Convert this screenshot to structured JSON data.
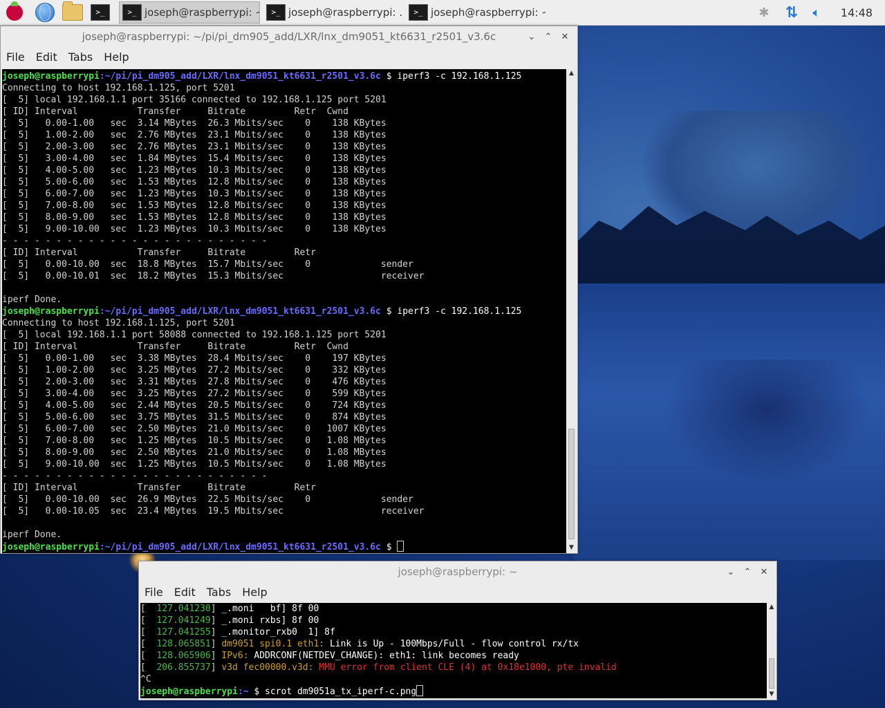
{
  "taskbar": {
    "tasks": [
      {
        "label": "joseph@raspberrypi: ~",
        "active": true
      },
      {
        "label": "joseph@raspberrypi: ..."
      },
      {
        "label": "joseph@raspberrypi: ~"
      }
    ],
    "clock": "14:48"
  },
  "win1": {
    "title": "joseph@raspberrypi: ~/pi/pi_dm905_add/LXR/lnx_dm9051_kt6631_r2501_v3.6c",
    "menu": [
      "File",
      "Edit",
      "Tabs",
      "Help"
    ],
    "prompt_user": "joseph@raspberrypi",
    "prompt_path": ":~/pi/pi_dm905_add/LXR/lnx_dm9051_kt6631_r2501_v3.6c",
    "prompt_sym": " $ ",
    "lines": [
      {
        "t": "prompt",
        "cmd": "iperf3 -c 192.168.1.125"
      },
      {
        "t": "text",
        "s": "Connecting to host 192.168.1.125, port 5201"
      },
      {
        "t": "text",
        "s": "[  5] local 192.168.1.1 port 35166 connected to 192.168.1.125 port 5201"
      },
      {
        "t": "text",
        "s": "[ ID] Interval           Transfer     Bitrate         Retr  Cwnd"
      },
      {
        "t": "text",
        "s": "[  5]   0.00-1.00   sec  3.14 MBytes  26.3 Mbits/sec    0    138 KBytes"
      },
      {
        "t": "text",
        "s": "[  5]   1.00-2.00   sec  2.76 MBytes  23.1 Mbits/sec    0    138 KBytes"
      },
      {
        "t": "text",
        "s": "[  5]   2.00-3.00   sec  2.76 MBytes  23.1 Mbits/sec    0    138 KBytes"
      },
      {
        "t": "text",
        "s": "[  5]   3.00-4.00   sec  1.84 MBytes  15.4 Mbits/sec    0    138 KBytes"
      },
      {
        "t": "text",
        "s": "[  5]   4.00-5.00   sec  1.23 MBytes  10.3 Mbits/sec    0    138 KBytes"
      },
      {
        "t": "text",
        "s": "[  5]   5.00-6.00   sec  1.53 MBytes  12.8 Mbits/sec    0    138 KBytes"
      },
      {
        "t": "text",
        "s": "[  5]   6.00-7.00   sec  1.23 MBytes  10.3 Mbits/sec    0    138 KBytes"
      },
      {
        "t": "text",
        "s": "[  5]   7.00-8.00   sec  1.53 MBytes  12.8 Mbits/sec    0    138 KBytes"
      },
      {
        "t": "text",
        "s": "[  5]   8.00-9.00   sec  1.53 MBytes  12.8 Mbits/sec    0    138 KBytes"
      },
      {
        "t": "text",
        "s": "[  5]   9.00-10.00  sec  1.23 MBytes  10.3 Mbits/sec    0    138 KBytes"
      },
      {
        "t": "text",
        "s": "- - - - - - - - - - - - - - - - - - - - - - - - -"
      },
      {
        "t": "text",
        "s": "[ ID] Interval           Transfer     Bitrate         Retr"
      },
      {
        "t": "text",
        "s": "[  5]   0.00-10.00  sec  18.8 MBytes  15.7 Mbits/sec    0             sender"
      },
      {
        "t": "text",
        "s": "[  5]   0.00-10.01  sec  18.2 MBytes  15.3 Mbits/sec                  receiver"
      },
      {
        "t": "text",
        "s": ""
      },
      {
        "t": "text",
        "s": "iperf Done."
      },
      {
        "t": "prompt",
        "cmd": "iperf3 -c 192.168.1.125"
      },
      {
        "t": "text",
        "s": "Connecting to host 192.168.1.125, port 5201"
      },
      {
        "t": "text",
        "s": "[  5] local 192.168.1.1 port 58088 connected to 192.168.1.125 port 5201"
      },
      {
        "t": "text",
        "s": "[ ID] Interval           Transfer     Bitrate         Retr  Cwnd"
      },
      {
        "t": "text",
        "s": "[  5]   0.00-1.00   sec  3.38 MBytes  28.4 Mbits/sec    0    197 KBytes"
      },
      {
        "t": "text",
        "s": "[  5]   1.00-2.00   sec  3.25 MBytes  27.2 Mbits/sec    0    332 KBytes"
      },
      {
        "t": "text",
        "s": "[  5]   2.00-3.00   sec  3.31 MBytes  27.8 Mbits/sec    0    476 KBytes"
      },
      {
        "t": "text",
        "s": "[  5]   3.00-4.00   sec  3.25 MBytes  27.2 Mbits/sec    0    599 KBytes"
      },
      {
        "t": "text",
        "s": "[  5]   4.00-5.00   sec  2.44 MBytes  20.5 Mbits/sec    0    724 KBytes"
      },
      {
        "t": "text",
        "s": "[  5]   5.00-6.00   sec  3.75 MBytes  31.5 Mbits/sec    0    874 KBytes"
      },
      {
        "t": "text",
        "s": "[  5]   6.00-7.00   sec  2.50 MBytes  21.0 Mbits/sec    0   1007 KBytes"
      },
      {
        "t": "text",
        "s": "[  5]   7.00-8.00   sec  1.25 MBytes  10.5 Mbits/sec    0   1.08 MBytes"
      },
      {
        "t": "text",
        "s": "[  5]   8.00-9.00   sec  2.50 MBytes  21.0 Mbits/sec    0   1.08 MBytes"
      },
      {
        "t": "text",
        "s": "[  5]   9.00-10.00  sec  1.25 MBytes  10.5 Mbits/sec    0   1.08 MBytes"
      },
      {
        "t": "text",
        "s": "- - - - - - - - - - - - - - - - - - - - - - - - -"
      },
      {
        "t": "text",
        "s": "[ ID] Interval           Transfer     Bitrate         Retr"
      },
      {
        "t": "text",
        "s": "[  5]   0.00-10.00  sec  26.9 MBytes  22.5 Mbits/sec    0             sender"
      },
      {
        "t": "text",
        "s": "[  5]   0.00-10.05  sec  23.4 MBytes  19.5 Mbits/sec                  receiver"
      },
      {
        "t": "text",
        "s": ""
      },
      {
        "t": "text",
        "s": "iperf Done."
      },
      {
        "t": "prompt",
        "cmd": "",
        "cursor": true
      }
    ]
  },
  "win2": {
    "title": "joseph@raspberrypi: ~",
    "menu": [
      "File",
      "Edit",
      "Tabs",
      "Help"
    ],
    "lines": [
      {
        "t": "dmesg",
        "ts": "  127.041230",
        "rest": "_.moni   bf] 8f 00"
      },
      {
        "t": "dmesg",
        "ts": "  127.041249",
        "rest": "_.moni rxbs] 8f 00"
      },
      {
        "t": "dmesg",
        "ts": "  127.041255",
        "rest": "_.monitor_rxb0  1] 8f"
      },
      {
        "t": "dmesg",
        "ts": "  128.065851",
        "src": "dm9051 spi0.1 eth1:",
        "rest": " Link is Up - 100Mbps/Full - flow control rx/tx"
      },
      {
        "t": "dmesg",
        "ts": "  128.065906",
        "src": "IPv6:",
        "rest": " ADDRCONF(NETDEV_CHANGE): eth1: link becomes ready"
      },
      {
        "t": "dmesg",
        "ts": "  206.855737",
        "src": "v3d fec00000.v3d:",
        "err": " MMU error from client CLE (4) at 0x18e1000, pte invalid"
      },
      {
        "t": "text",
        "s": "^C"
      },
      {
        "t": "prompt",
        "user": "joseph@raspberrypi",
        "path": ":~",
        "sym": " $ ",
        "cmd": "scrot dm9051a_tx_iperf-c.png",
        "cursor": true
      }
    ]
  }
}
